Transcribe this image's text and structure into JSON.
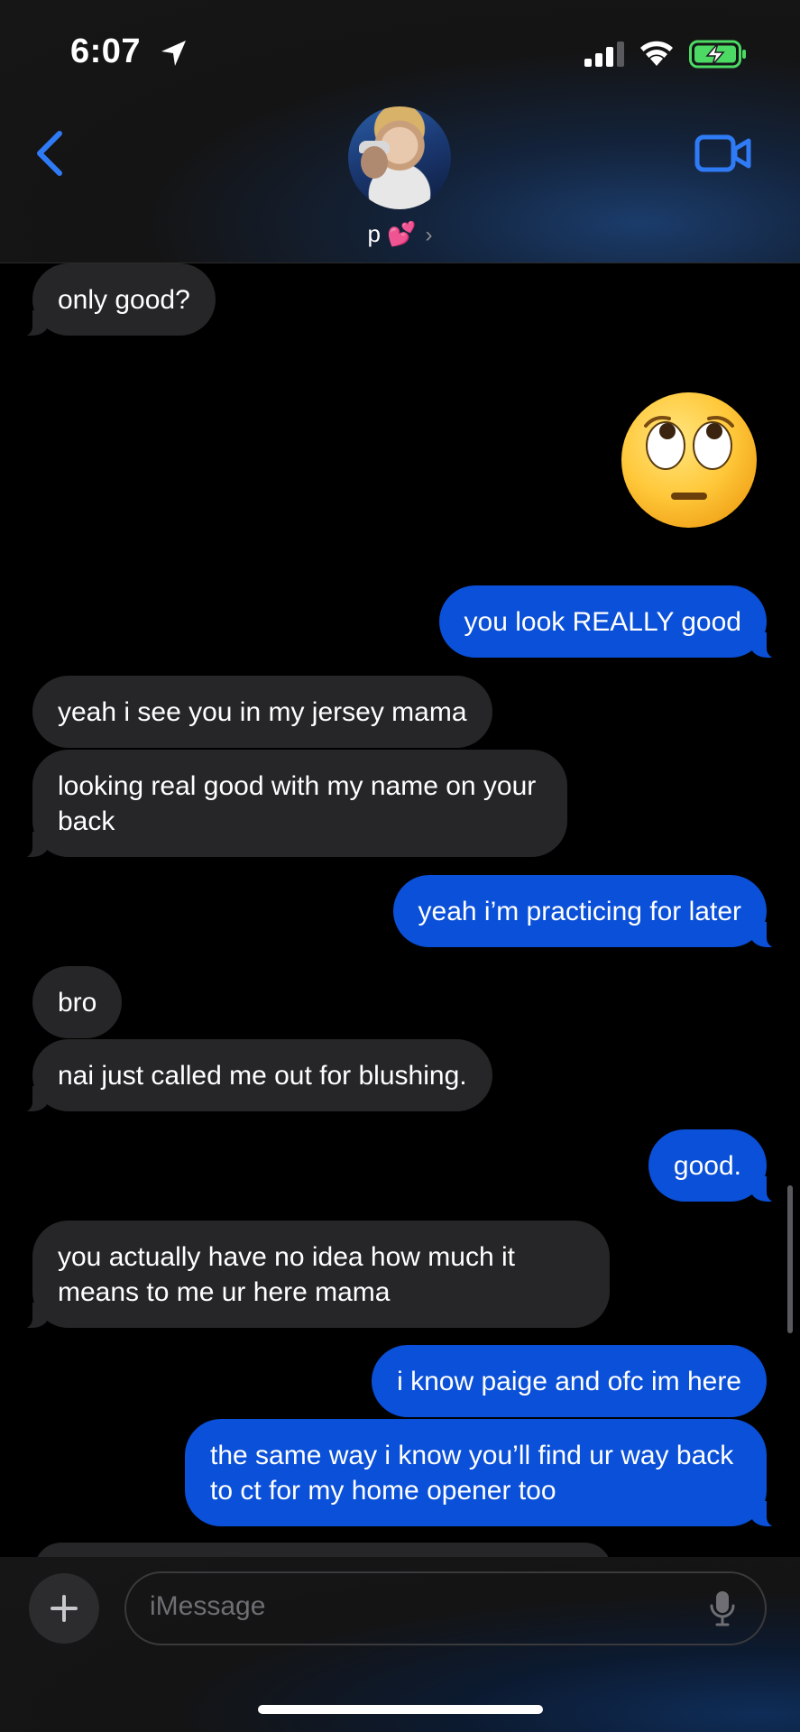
{
  "status_bar": {
    "time": "6:07"
  },
  "header": {
    "contact_name": "p 💕",
    "chevron": "›",
    "accent": "#2f7bf6"
  },
  "messages": [
    {
      "side": "incoming",
      "text": "only good?"
    },
    {
      "side": "outgoing",
      "text": "🙄",
      "type": "emoji"
    },
    {
      "side": "outgoing",
      "text": "you look REALLY good"
    },
    {
      "side": "incoming",
      "text": "yeah i see you in my jersey mama"
    },
    {
      "side": "incoming",
      "text": "looking real good with my name on your back"
    },
    {
      "side": "outgoing",
      "text": "yeah i’m practicing for later"
    },
    {
      "side": "incoming",
      "text": "bro"
    },
    {
      "side": "incoming",
      "text": "nai just called me out for blushing."
    },
    {
      "side": "outgoing",
      "text": "good."
    },
    {
      "side": "incoming",
      "text": "you actually have no idea how much it means to me ur here mama"
    },
    {
      "side": "outgoing",
      "text": "i know paige and ofc im here"
    },
    {
      "side": "outgoing",
      "text": "the same way i know you’ll find ur way back to ct for my home opener too"
    }
  ],
  "composer": {
    "placeholder": "iMessage"
  },
  "colors": {
    "incoming_bubble": "#262628",
    "outgoing_bubble": "#0a50d8",
    "battery_green": "#4cd964"
  }
}
